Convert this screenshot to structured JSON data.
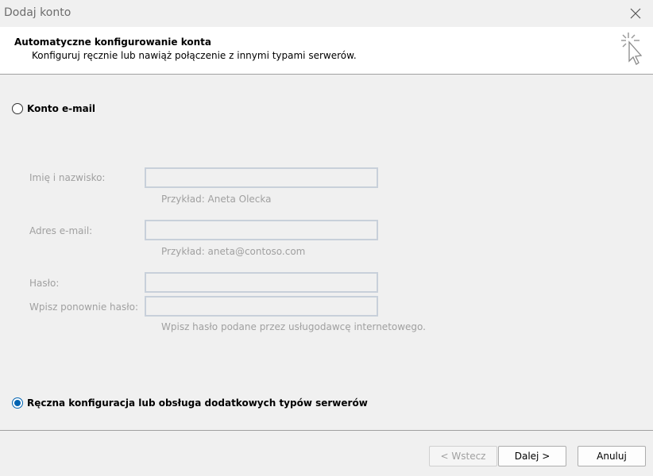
{
  "window": {
    "title": "Dodaj konto"
  },
  "header": {
    "title": "Automatyczne konfigurowanie konta",
    "subtitle": "Konfiguruj ręcznie lub nawiąż połączenie z innymi typami serwerów."
  },
  "options": {
    "email_account": {
      "label": "Konto e-mail",
      "selected": false
    },
    "manual_config": {
      "label": "Ręczna konfiguracja lub obsługa dodatkowych typów serwerów",
      "selected": true
    }
  },
  "form": {
    "name": {
      "label": "Imię i nazwisko:",
      "value": "",
      "hint": "Przykład: Aneta Olecka"
    },
    "email": {
      "label": "Adres e-mail:",
      "value": "",
      "hint": "Przykład: aneta@contoso.com"
    },
    "password": {
      "label": "Hasło:",
      "value": ""
    },
    "password_repeat": {
      "label": "Wpisz ponownie hasło:",
      "value": "",
      "hint": "Wpisz hasło podane przez usługodawcę internetowego."
    }
  },
  "buttons": {
    "back": "< Wstecz",
    "next": "Dalej >",
    "cancel": "Anuluj"
  },
  "colors": {
    "accent": "#0063b1",
    "disabled_text": "#a0a0a0"
  }
}
